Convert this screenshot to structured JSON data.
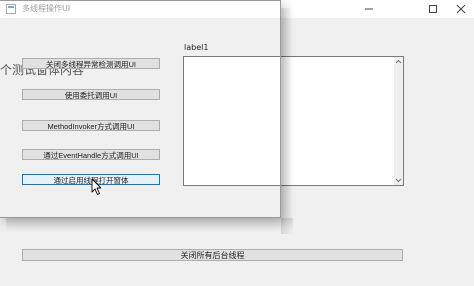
{
  "window": {
    "title": "多线程操作UI"
  },
  "buttons": [
    {
      "label": "关闭多线程异常检测调用UI"
    },
    {
      "label": "使用委托调用UI"
    },
    {
      "label": "MethodInvoker方式调用UI"
    },
    {
      "label": "通过EventHandle方式调用UI"
    },
    {
      "label": "通过启用线程打开窗体"
    }
  ],
  "label1": "label1",
  "close_all_button": "关闭所有后台线程",
  "child_form_text": "个测试窗体内容",
  "icons": {
    "minimize": "minimize-icon",
    "maximize": "maximize-icon",
    "close": "close-icon",
    "cursor": "mouse-cursor-icon"
  }
}
